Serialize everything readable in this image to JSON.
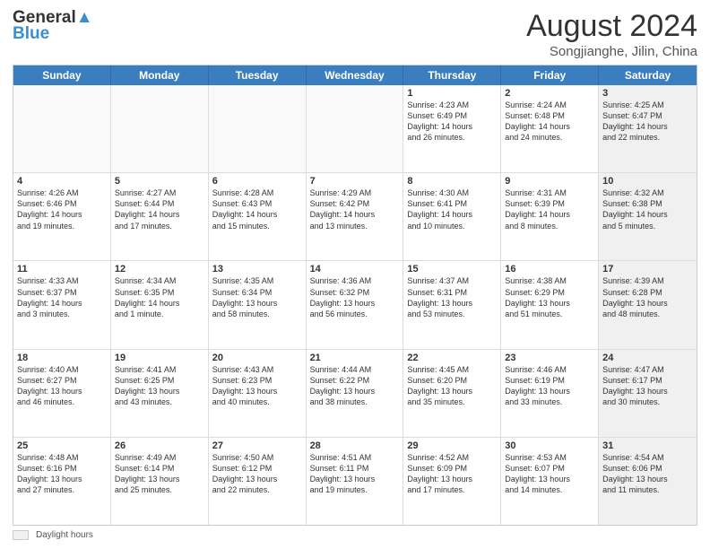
{
  "header": {
    "logo_line1": "General",
    "logo_line2": "Blue",
    "month_year": "August 2024",
    "location": "Songjianghe, Jilin, China"
  },
  "weekdays": [
    "Sunday",
    "Monday",
    "Tuesday",
    "Wednesday",
    "Thursday",
    "Friday",
    "Saturday"
  ],
  "weeks": [
    [
      {
        "day": "",
        "text": "",
        "empty": true
      },
      {
        "day": "",
        "text": "",
        "empty": true
      },
      {
        "day": "",
        "text": "",
        "empty": true
      },
      {
        "day": "",
        "text": "",
        "empty": true
      },
      {
        "day": "1",
        "text": "Sunrise: 4:23 AM\nSunset: 6:49 PM\nDaylight: 14 hours\nand 26 minutes.",
        "empty": false
      },
      {
        "day": "2",
        "text": "Sunrise: 4:24 AM\nSunset: 6:48 PM\nDaylight: 14 hours\nand 24 minutes.",
        "empty": false
      },
      {
        "day": "3",
        "text": "Sunrise: 4:25 AM\nSunset: 6:47 PM\nDaylight: 14 hours\nand 22 minutes.",
        "empty": false,
        "shaded": true
      }
    ],
    [
      {
        "day": "4",
        "text": "Sunrise: 4:26 AM\nSunset: 6:46 PM\nDaylight: 14 hours\nand 19 minutes.",
        "empty": false
      },
      {
        "day": "5",
        "text": "Sunrise: 4:27 AM\nSunset: 6:44 PM\nDaylight: 14 hours\nand 17 minutes.",
        "empty": false
      },
      {
        "day": "6",
        "text": "Sunrise: 4:28 AM\nSunset: 6:43 PM\nDaylight: 14 hours\nand 15 minutes.",
        "empty": false
      },
      {
        "day": "7",
        "text": "Sunrise: 4:29 AM\nSunset: 6:42 PM\nDaylight: 14 hours\nand 13 minutes.",
        "empty": false
      },
      {
        "day": "8",
        "text": "Sunrise: 4:30 AM\nSunset: 6:41 PM\nDaylight: 14 hours\nand 10 minutes.",
        "empty": false
      },
      {
        "day": "9",
        "text": "Sunrise: 4:31 AM\nSunset: 6:39 PM\nDaylight: 14 hours\nand 8 minutes.",
        "empty": false
      },
      {
        "day": "10",
        "text": "Sunrise: 4:32 AM\nSunset: 6:38 PM\nDaylight: 14 hours\nand 5 minutes.",
        "empty": false,
        "shaded": true
      }
    ],
    [
      {
        "day": "11",
        "text": "Sunrise: 4:33 AM\nSunset: 6:37 PM\nDaylight: 14 hours\nand 3 minutes.",
        "empty": false
      },
      {
        "day": "12",
        "text": "Sunrise: 4:34 AM\nSunset: 6:35 PM\nDaylight: 14 hours\nand 1 minute.",
        "empty": false
      },
      {
        "day": "13",
        "text": "Sunrise: 4:35 AM\nSunset: 6:34 PM\nDaylight: 13 hours\nand 58 minutes.",
        "empty": false
      },
      {
        "day": "14",
        "text": "Sunrise: 4:36 AM\nSunset: 6:32 PM\nDaylight: 13 hours\nand 56 minutes.",
        "empty": false
      },
      {
        "day": "15",
        "text": "Sunrise: 4:37 AM\nSunset: 6:31 PM\nDaylight: 13 hours\nand 53 minutes.",
        "empty": false
      },
      {
        "day": "16",
        "text": "Sunrise: 4:38 AM\nSunset: 6:29 PM\nDaylight: 13 hours\nand 51 minutes.",
        "empty": false
      },
      {
        "day": "17",
        "text": "Sunrise: 4:39 AM\nSunset: 6:28 PM\nDaylight: 13 hours\nand 48 minutes.",
        "empty": false,
        "shaded": true
      }
    ],
    [
      {
        "day": "18",
        "text": "Sunrise: 4:40 AM\nSunset: 6:27 PM\nDaylight: 13 hours\nand 46 minutes.",
        "empty": false
      },
      {
        "day": "19",
        "text": "Sunrise: 4:41 AM\nSunset: 6:25 PM\nDaylight: 13 hours\nand 43 minutes.",
        "empty": false
      },
      {
        "day": "20",
        "text": "Sunrise: 4:43 AM\nSunset: 6:23 PM\nDaylight: 13 hours\nand 40 minutes.",
        "empty": false
      },
      {
        "day": "21",
        "text": "Sunrise: 4:44 AM\nSunset: 6:22 PM\nDaylight: 13 hours\nand 38 minutes.",
        "empty": false
      },
      {
        "day": "22",
        "text": "Sunrise: 4:45 AM\nSunset: 6:20 PM\nDaylight: 13 hours\nand 35 minutes.",
        "empty": false
      },
      {
        "day": "23",
        "text": "Sunrise: 4:46 AM\nSunset: 6:19 PM\nDaylight: 13 hours\nand 33 minutes.",
        "empty": false
      },
      {
        "day": "24",
        "text": "Sunrise: 4:47 AM\nSunset: 6:17 PM\nDaylight: 13 hours\nand 30 minutes.",
        "empty": false,
        "shaded": true
      }
    ],
    [
      {
        "day": "25",
        "text": "Sunrise: 4:48 AM\nSunset: 6:16 PM\nDaylight: 13 hours\nand 27 minutes.",
        "empty": false
      },
      {
        "day": "26",
        "text": "Sunrise: 4:49 AM\nSunset: 6:14 PM\nDaylight: 13 hours\nand 25 minutes.",
        "empty": false
      },
      {
        "day": "27",
        "text": "Sunrise: 4:50 AM\nSunset: 6:12 PM\nDaylight: 13 hours\nand 22 minutes.",
        "empty": false
      },
      {
        "day": "28",
        "text": "Sunrise: 4:51 AM\nSunset: 6:11 PM\nDaylight: 13 hours\nand 19 minutes.",
        "empty": false
      },
      {
        "day": "29",
        "text": "Sunrise: 4:52 AM\nSunset: 6:09 PM\nDaylight: 13 hours\nand 17 minutes.",
        "empty": false
      },
      {
        "day": "30",
        "text": "Sunrise: 4:53 AM\nSunset: 6:07 PM\nDaylight: 13 hours\nand 14 minutes.",
        "empty": false
      },
      {
        "day": "31",
        "text": "Sunrise: 4:54 AM\nSunset: 6:06 PM\nDaylight: 13 hours\nand 11 minutes.",
        "empty": false,
        "shaded": true
      }
    ]
  ],
  "footer": {
    "shaded_label": "Daylight hours"
  }
}
